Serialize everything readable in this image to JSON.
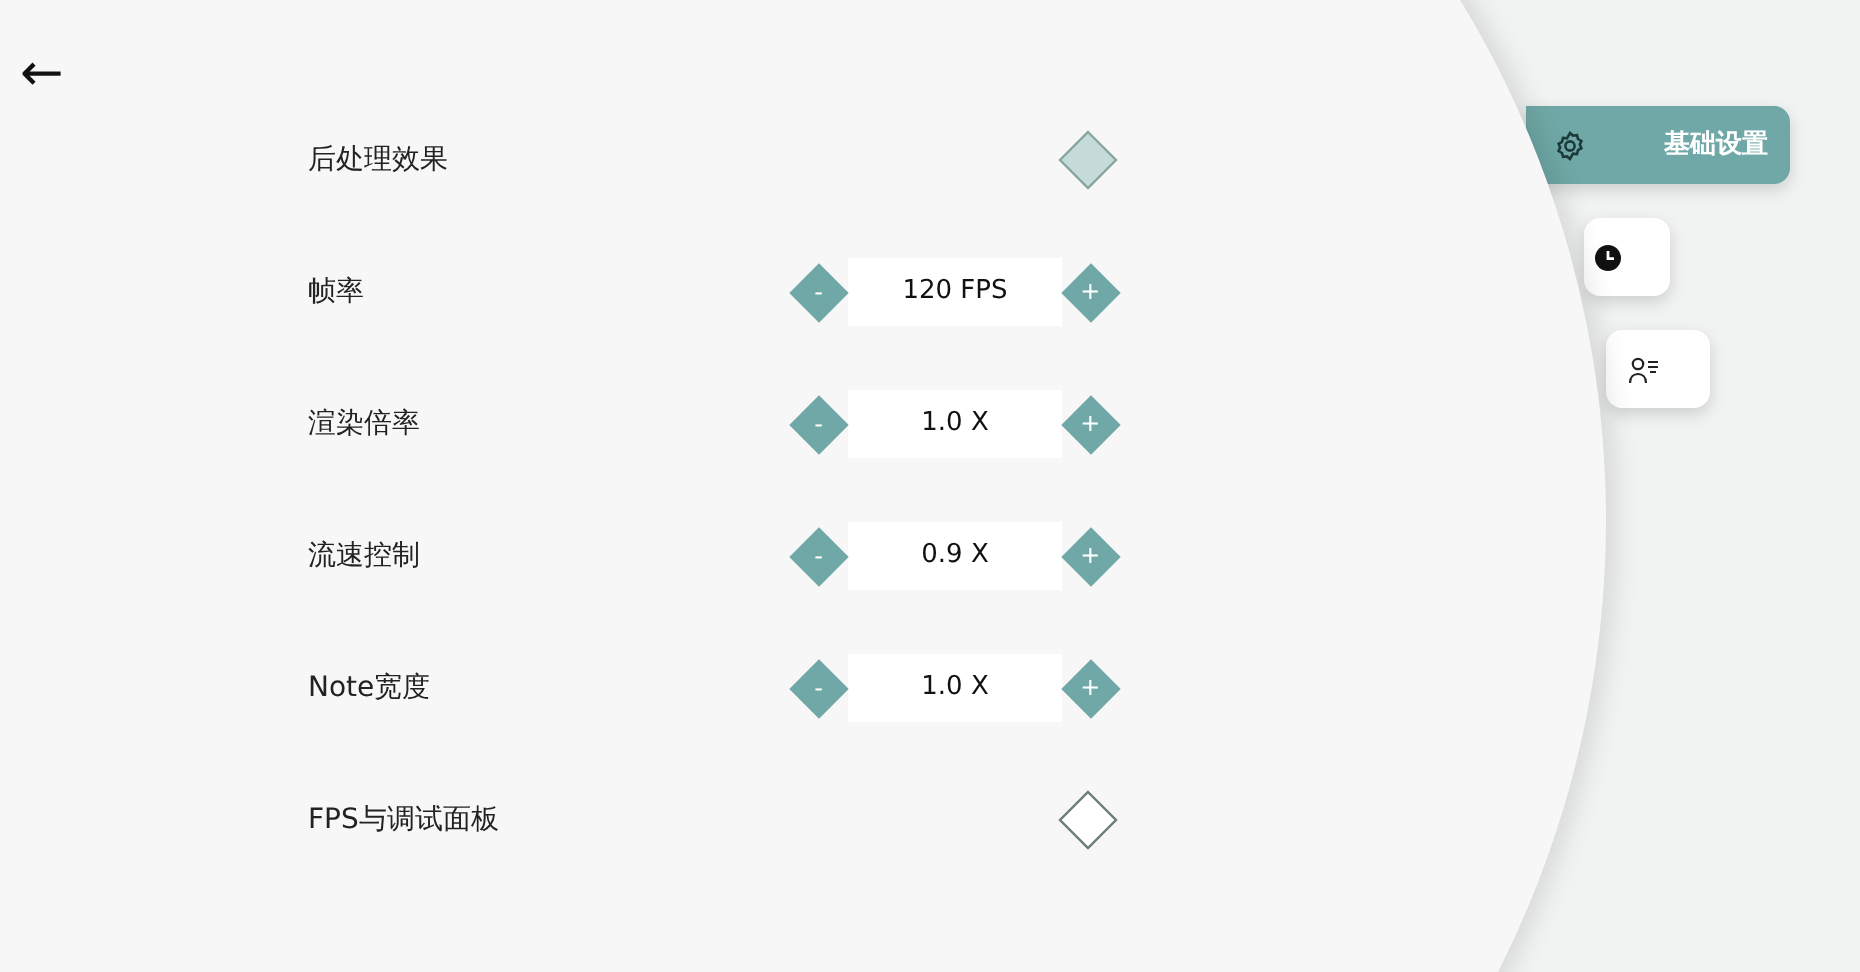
{
  "back": {
    "label": "←"
  },
  "tabs": [
    {
      "label": "基础设置",
      "selected": true
    },
    {
      "selected": false
    },
    {
      "selected": false
    }
  ],
  "settings": [
    {
      "kind": "toggle",
      "label": "后处理效果",
      "on": true
    },
    {
      "kind": "stepper",
      "label": "帧率",
      "value": "120 FPS",
      "minus": "-",
      "plus": "+"
    },
    {
      "kind": "stepper",
      "label": "渲染倍率",
      "value": "1.0 X",
      "minus": "-",
      "plus": "+"
    },
    {
      "kind": "stepper",
      "label": "流速控制",
      "value": "0.9 X",
      "minus": "-",
      "plus": "+"
    },
    {
      "kind": "stepper",
      "label": "Note宽度",
      "value": "1.0 X",
      "minus": "-",
      "plus": "+"
    },
    {
      "kind": "toggle",
      "label": "FPS与调试面板",
      "on": false
    }
  ]
}
